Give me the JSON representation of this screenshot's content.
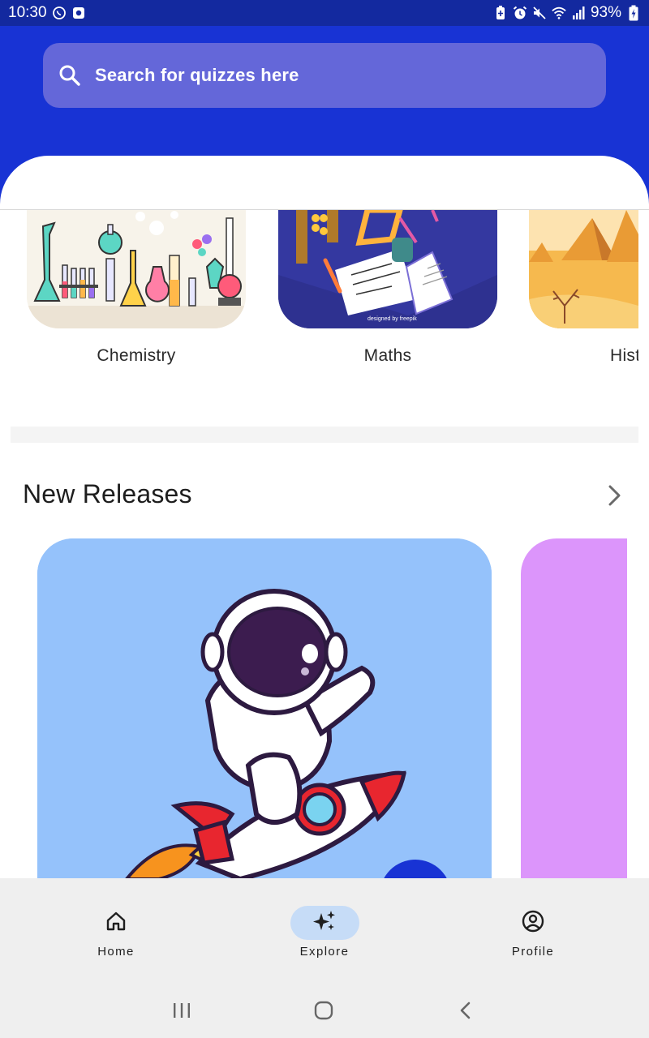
{
  "status_bar": {
    "time": "10:30",
    "battery": "93%",
    "left_icons": [
      "whatsapp-icon",
      "app-notification-icon"
    ],
    "right_icons": [
      "battery-saver-icon",
      "alarm-icon",
      "mute-icon",
      "wifi-icon",
      "signal-icon",
      "battery-charging-icon"
    ]
  },
  "search": {
    "placeholder": "Search for quizzes here",
    "icon": "search-icon"
  },
  "categories": [
    {
      "label": "Chemistry",
      "image": "chemistry-lab-illustration"
    },
    {
      "label": "Maths",
      "image": "maths-desk-illustration"
    },
    {
      "label": "Hist",
      "image": "pyramids-desert-illustration"
    }
  ],
  "new_releases": {
    "title": "New Releases",
    "chevron": "chevron-right-icon",
    "cards": [
      {
        "image": "astronaut-on-rocket-illustration",
        "color": "#95c2fb"
      },
      {
        "image": "purple-card",
        "color": "#dc95fb"
      }
    ]
  },
  "bottom_nav": {
    "items": [
      {
        "label": "Home",
        "icon": "home-icon",
        "active": false
      },
      {
        "label": "Explore",
        "icon": "sparkles-icon",
        "active": true
      },
      {
        "label": "Profile",
        "icon": "profile-icon",
        "active": false
      }
    ]
  },
  "system_nav": [
    "recent-apps-icon",
    "home-circle-icon",
    "back-icon"
  ],
  "colors": {
    "header": "#1833d4",
    "status_bar": "#13299f",
    "search_bar": "#6467d9",
    "nav_active": "#c6dcf7",
    "nav_background": "#efefef"
  }
}
